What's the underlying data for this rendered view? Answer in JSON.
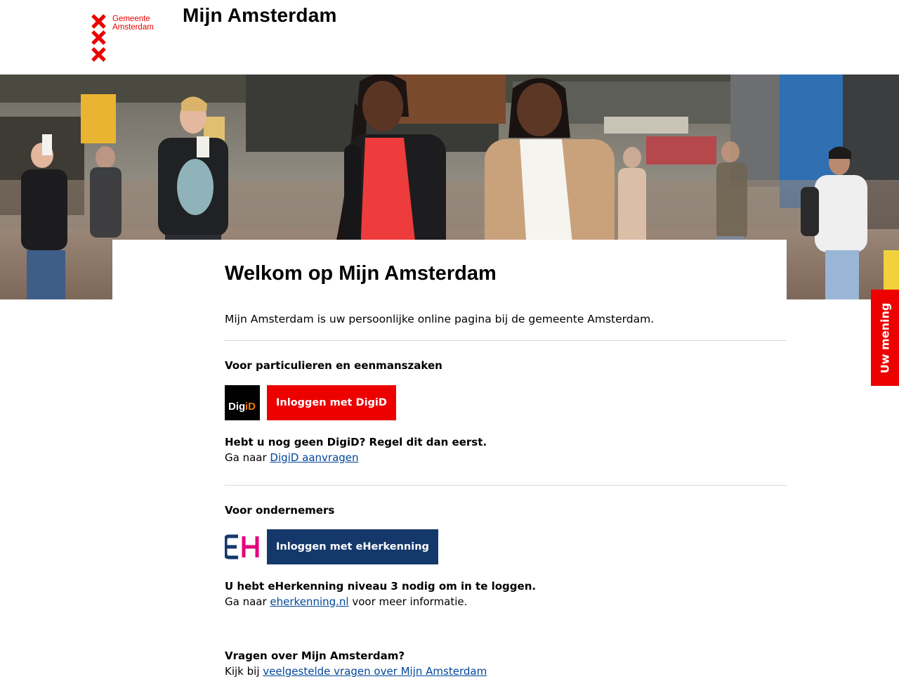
{
  "header": {
    "logo_line1": "Gemeente",
    "logo_line2": "Amsterdam",
    "site_title": "Mijn Amsterdam"
  },
  "hero": {
    "image_alt": "Straatbeeld met wandelende mensen"
  },
  "main": {
    "title": "Welkom op Mijn Amsterdam",
    "intro": "Mijn Amsterdam is uw persoonlijke online pagina bij de gemeente Amsterdam.",
    "private": {
      "heading": "Voor particulieren en eenmanszaken",
      "logo_part1": "Dig",
      "logo_part2": "iD",
      "button": "Inloggen met DigiD",
      "note_bold": "Hebt u nog geen DigiD? Regel dit dan eerst.",
      "note_prefix": "Ga naar ",
      "note_link": "DigiD aanvragen"
    },
    "business": {
      "heading": "Voor ondernemers",
      "button": "Inloggen met eHerkenning",
      "note_bold": "U hebt eHerkenning niveau 3 nodig om in te loggen.",
      "note_prefix": "Ga naar ",
      "note_link": "eherkenning.nl",
      "note_suffix": " voor meer informatie."
    },
    "faq": {
      "heading": "Vragen over Mijn Amsterdam?",
      "prefix": "Kijk bij ",
      "link": "veelgestelde vragen over Mijn Amsterdam"
    }
  },
  "feedback": {
    "label": "Uw mening"
  },
  "colors": {
    "brand_red": "#ec0000",
    "eherkenning_blue": "#15386b",
    "link_blue": "#004699",
    "eherkenning_pink": "#e5007e"
  }
}
